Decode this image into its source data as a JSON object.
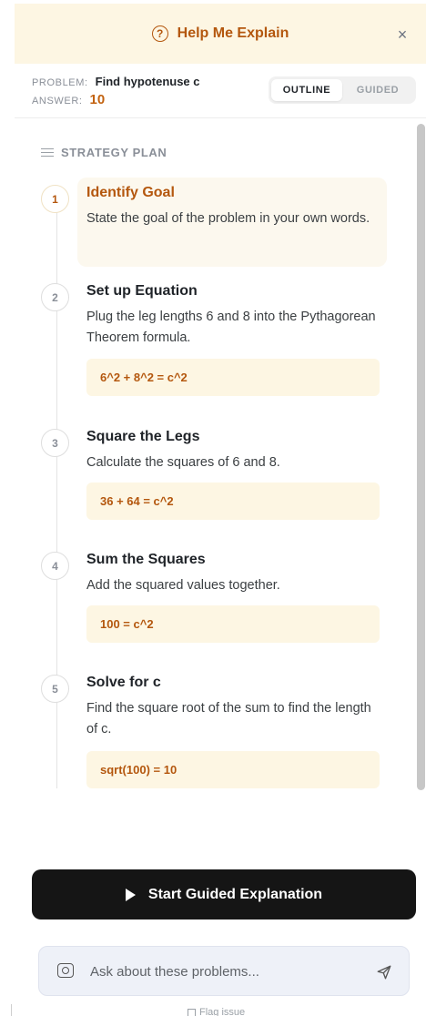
{
  "header": {
    "title": "Help Me Explain",
    "help_icon": "question-circle-icon",
    "help_glyph": "?",
    "close_icon": "close-icon",
    "close_glyph": "×"
  },
  "problem": {
    "problem_key": "PROBLEM:",
    "problem_value": "Find hypotenuse c",
    "answer_key": "ANSWER:",
    "answer_value": "10"
  },
  "mode_toggle": {
    "options": [
      "OUTLINE",
      "GUIDED"
    ],
    "selected": "OUTLINE"
  },
  "strategy": {
    "heading": "STRATEGY PLAN",
    "steps": [
      {
        "number": "1",
        "title": "Identify Goal",
        "description": "State the goal of the problem in your own words.",
        "formula": ""
      },
      {
        "number": "2",
        "title": "Set up Equation",
        "description": "Plug the leg lengths 6 and 8 into the Pythagorean Theorem formula.",
        "formula": "6^2 + 8^2 = c^2"
      },
      {
        "number": "3",
        "title": "Square the Legs",
        "description": "Calculate the squares of 6 and 8.",
        "formula": "36 + 64 = c^2"
      },
      {
        "number": "4",
        "title": "Sum the Squares",
        "description": "Add the squared values together.",
        "formula": "100 = c^2"
      },
      {
        "number": "5",
        "title": "Solve for c",
        "description": "Find the square root of the sum to find the length of c.",
        "formula": "sqrt(100) = 10"
      }
    ]
  },
  "cta": {
    "label": "Start Guided Explanation",
    "icon": "play-icon"
  },
  "chat": {
    "placeholder": "Ask about these problems...",
    "value": "",
    "camera_icon": "camera-icon",
    "send_icon": "send-icon"
  },
  "footer": {
    "flag_label": "Flag issue"
  },
  "colors": {
    "accent": "#b4570e",
    "header_bg": "#fdf6e3",
    "cta_bg": "#151515"
  }
}
